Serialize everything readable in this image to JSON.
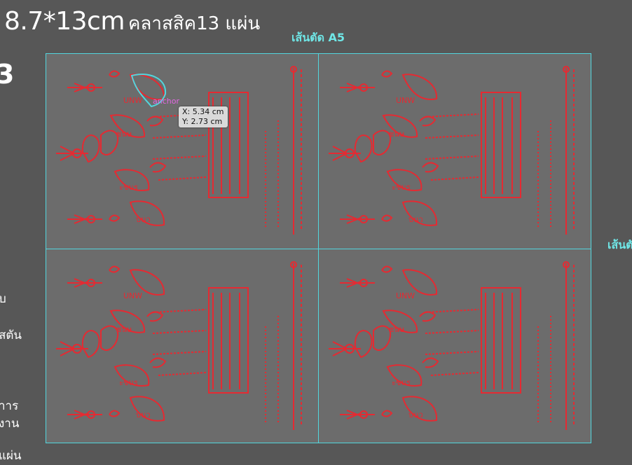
{
  "header": {
    "size_text": "8.7*13cm",
    "label_text": "คลาสสิค13 แผ่น"
  },
  "guides": {
    "top_label": "เส้นตัด A5",
    "right_label": "เส้นตั"
  },
  "left_panel": {
    "glyph": "3",
    "fragments": [
      "บ",
      "สตัน",
      "าาร",
      "งาน",
      "แผ่น"
    ]
  },
  "cursor": {
    "anchor_label": "anchor",
    "x_readout": "X: 5.34 cm",
    "y_readout": "Y: 2.73 cm"
  },
  "colors": {
    "background": "#575757",
    "artboard": "#6c6c6c",
    "guide": "#52d6de",
    "artwork": "#e52a32",
    "anchor": "#e466e4"
  },
  "artwork": {
    "tiles": [
      "yantra-top-left",
      "yantra-top-right",
      "yantra-bottom-left",
      "yantra-bottom-right"
    ]
  }
}
